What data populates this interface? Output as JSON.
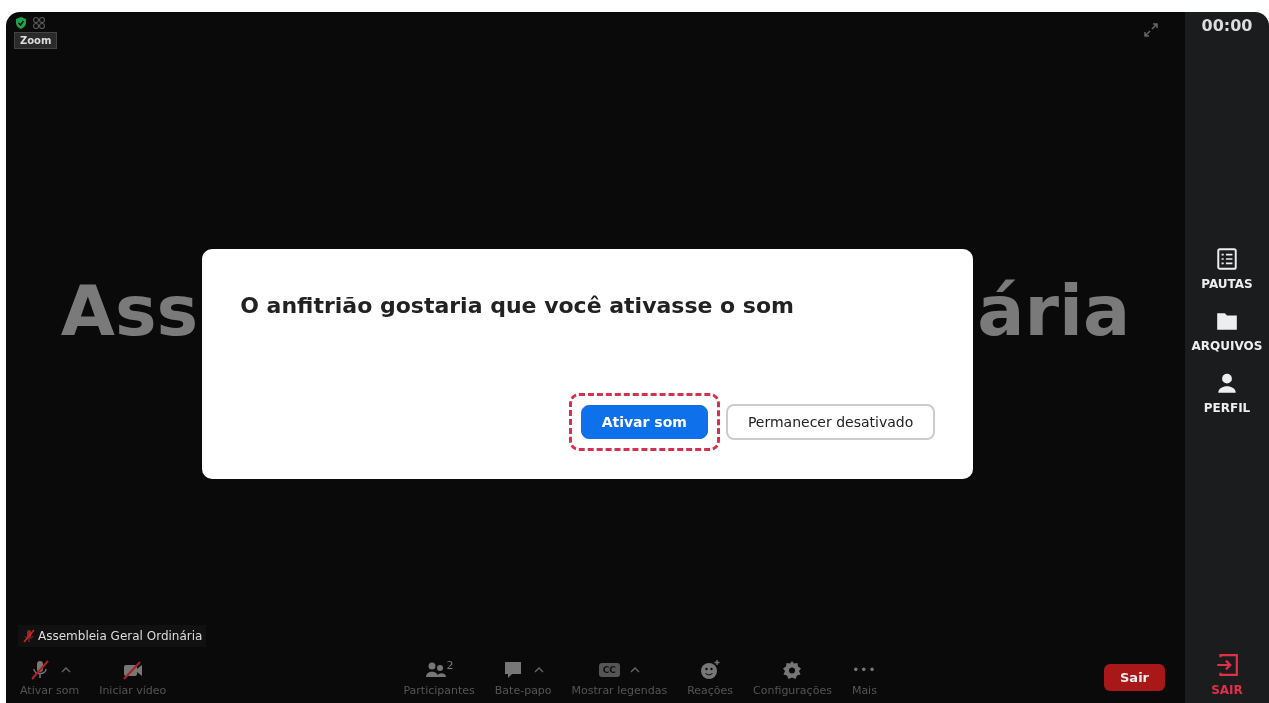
{
  "top_bar": {
    "app_label": "Zoom"
  },
  "background_title": {
    "visible_start": "Ass",
    "visible_end": "ária"
  },
  "dialog": {
    "title": "O anfitrião gostaria que você ativasse o som",
    "buttons": [
      {
        "label": "Ativar som",
        "kind": "primary",
        "highlighted": true
      },
      {
        "label": "Permanecer desativado",
        "kind": "secondary",
        "highlighted": false
      }
    ]
  },
  "participant_label": {
    "name": "Assembleia Geral Ordinária",
    "muted": true
  },
  "toolbar": {
    "items": [
      {
        "kind": "mic",
        "label": "Ativar som",
        "off": true,
        "has_menu": true
      },
      {
        "kind": "video",
        "label": "Iniciar vídeo",
        "off": true,
        "has_menu": false
      },
      {
        "kind": "participants",
        "label": "Participantes",
        "count": "2",
        "has_menu": false
      },
      {
        "kind": "chat",
        "label": "Bate-papo",
        "has_menu": true
      },
      {
        "kind": "captions",
        "label": "Mostrar legendas",
        "icon_text": "CC",
        "has_menu": true
      },
      {
        "kind": "reactions",
        "label": "Reações",
        "has_menu": false
      },
      {
        "kind": "settings",
        "label": "Configurações",
        "has_menu": false
      },
      {
        "kind": "more",
        "label": "Mais",
        "icon_text": "•••",
        "has_menu": false
      }
    ],
    "leave_button": "Sair"
  },
  "sidebar": {
    "timer": "00:00",
    "items": [
      {
        "kind": "list",
        "label": "PAUTAS"
      },
      {
        "kind": "folder",
        "label": "ARQUIVOS"
      },
      {
        "kind": "person",
        "label": "PERFIL"
      }
    ],
    "exit": {
      "label": "SAIR"
    }
  }
}
